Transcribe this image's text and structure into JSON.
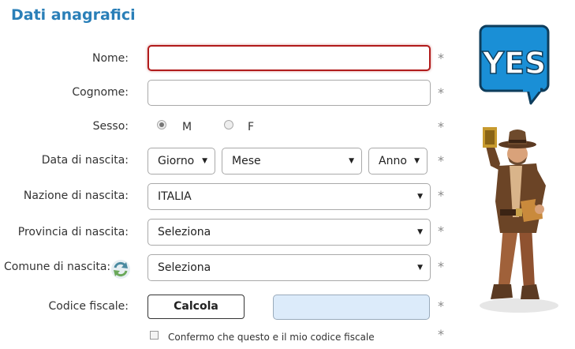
{
  "form": {
    "title": "Dati anagrafici",
    "required_mark": "*",
    "nome": {
      "label": "Nome:",
      "value": ""
    },
    "cognome": {
      "label": "Cognome:",
      "value": ""
    },
    "sesso": {
      "label": "Sesso:",
      "options": [
        "M",
        "F"
      ],
      "selected": "M"
    },
    "data_nascita": {
      "label": "Data di nascita:",
      "giorno": "Giorno",
      "mese": "Mese",
      "anno": "Anno"
    },
    "nazione": {
      "label": "Nazione di nascita:",
      "value": "ITALIA"
    },
    "provincia": {
      "label": "Provincia di nascita:",
      "value": "Seleziona"
    },
    "comune": {
      "label": "Comune di nascita:",
      "value": "Seleziona"
    },
    "codice_fiscale": {
      "label": "Codice fiscale:",
      "button": "Calcola",
      "value": ""
    },
    "conferma": {
      "label": "Confermo che questo e il mio codice fiscale",
      "checked": false
    }
  },
  "promo": {
    "badge_text": "YES",
    "badge_color": "#1a8fd6"
  },
  "icons": {
    "refresh": "refresh-icon",
    "dropdown": "chevron-down-icon"
  }
}
